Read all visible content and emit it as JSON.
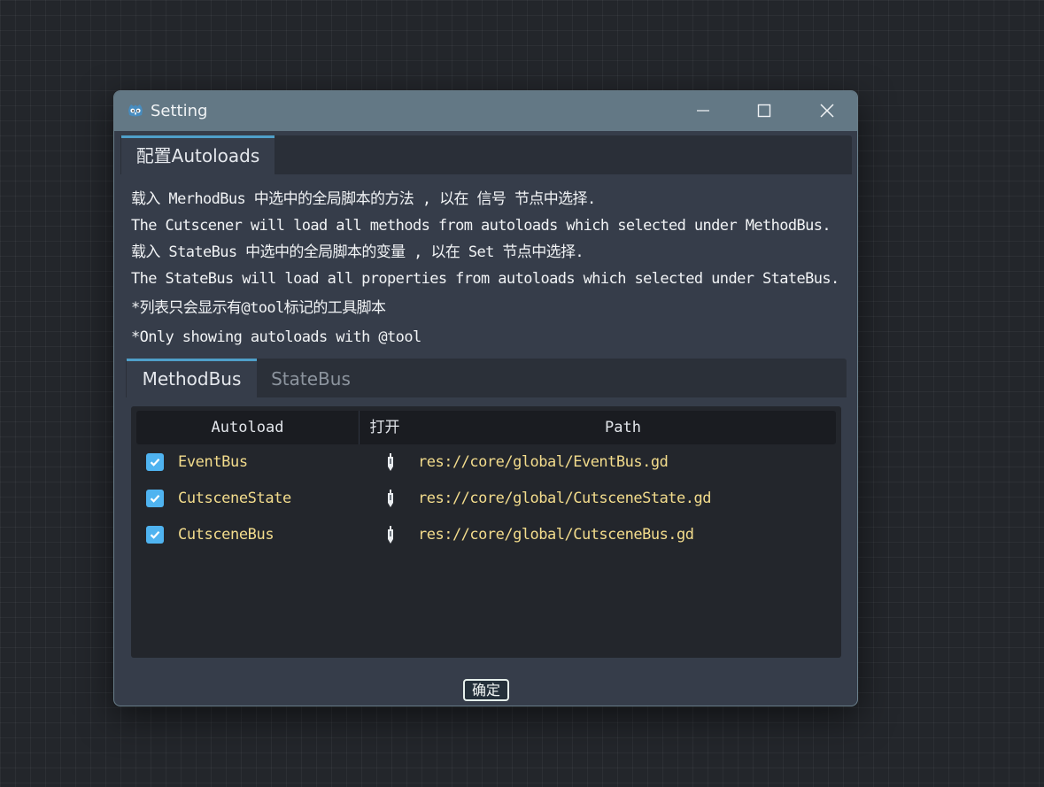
{
  "window": {
    "title": "Setting",
    "app_icon": "godot-icon",
    "controls": [
      "minimize-icon",
      "maximize-icon",
      "close-icon"
    ]
  },
  "outer_tabs": [
    {
      "label": "配置Autoloads",
      "active": true
    }
  ],
  "info_lines": [
    "载入 MerhodBus 中选中的全局脚本的方法 , 以在 信号 节点中选择.",
    "The Cutscener will load all methods from autoloads which selected under MethodBus.",
    "载入 StateBus 中选中的全局脚本的变量 , 以在 Set 节点中选择.",
    "The StateBus will load all properties from autoloads which selected under StateBus.",
    "*列表只会显示有@tool标记的工具脚本",
    "*Only showing autoloads with @tool"
  ],
  "inner_tabs": [
    {
      "label": "MethodBus",
      "active": true
    },
    {
      "label": "StateBus",
      "active": false
    }
  ],
  "table": {
    "columns": [
      "Autoload",
      "打开",
      "Path"
    ],
    "rows": [
      {
        "checked": true,
        "name": "EventBus",
        "open_icon": "edit-script-icon",
        "path": "res://core/global/EventBus.gd"
      },
      {
        "checked": true,
        "name": "CutsceneState",
        "open_icon": "edit-script-icon",
        "path": "res://core/global/CutsceneState.gd"
      },
      {
        "checked": true,
        "name": "CutsceneBus",
        "open_icon": "edit-script-icon",
        "path": "res://core/global/CutsceneBus.gd"
      }
    ]
  },
  "confirm_label": "确定",
  "colors": {
    "titlebar": "#637885",
    "accent": "#4f9fc9",
    "checkbox": "#4fb3f0",
    "autoload_text": "#f3dc8c",
    "panel": "#363d4a"
  }
}
